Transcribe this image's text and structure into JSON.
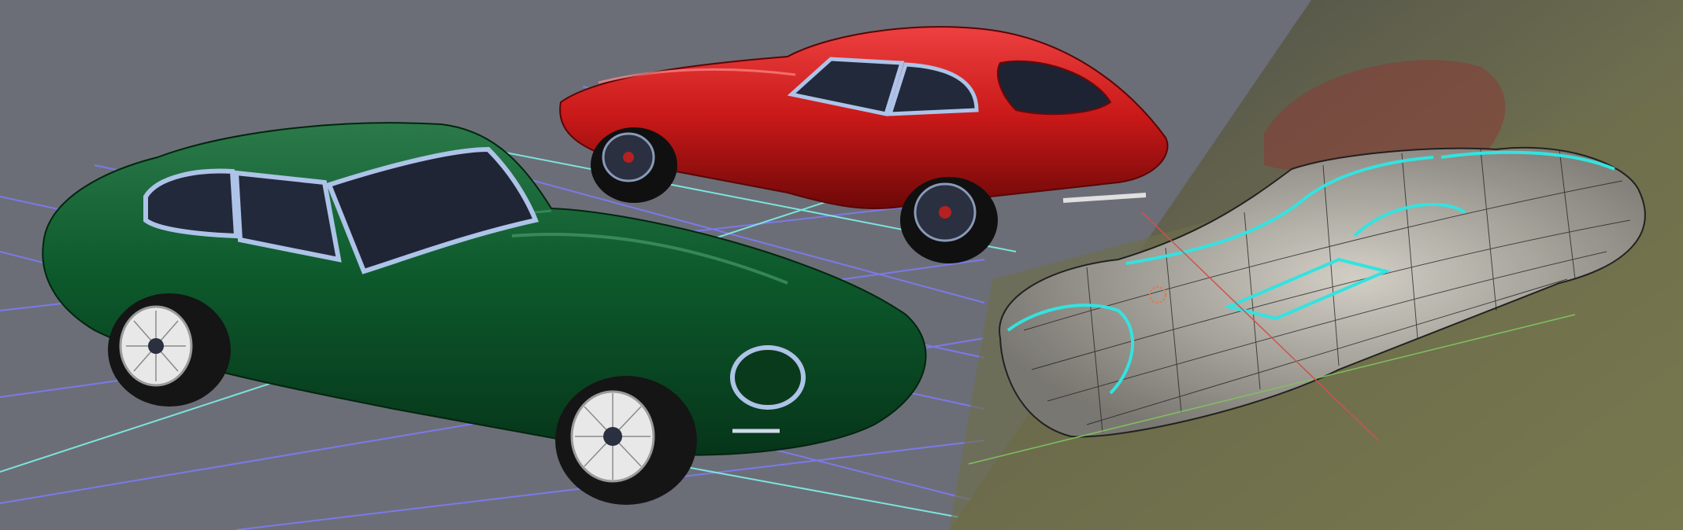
{
  "scene": {
    "background_color": "#6b6e77",
    "grid": {
      "line_color": "#7f7cff",
      "axis_color": "#7ff0e6"
    },
    "models": [
      {
        "id": "green-coupe",
        "body_color": "#0d5a2c",
        "glass_color": "#22293a",
        "trim_color": "#aec3e8",
        "wheel": "wire-spoke"
      },
      {
        "id": "red-coupe",
        "body_color": "#c81818",
        "glass_color": "#22293a",
        "trim_color": "#aec3e8",
        "wheel": "wire-spoke"
      }
    ],
    "wireframe_panel": {
      "mesh_color": "#1e1e1e",
      "selected_edge_color": "#33e3e0",
      "reference_tint": "#8a8a55"
    }
  }
}
